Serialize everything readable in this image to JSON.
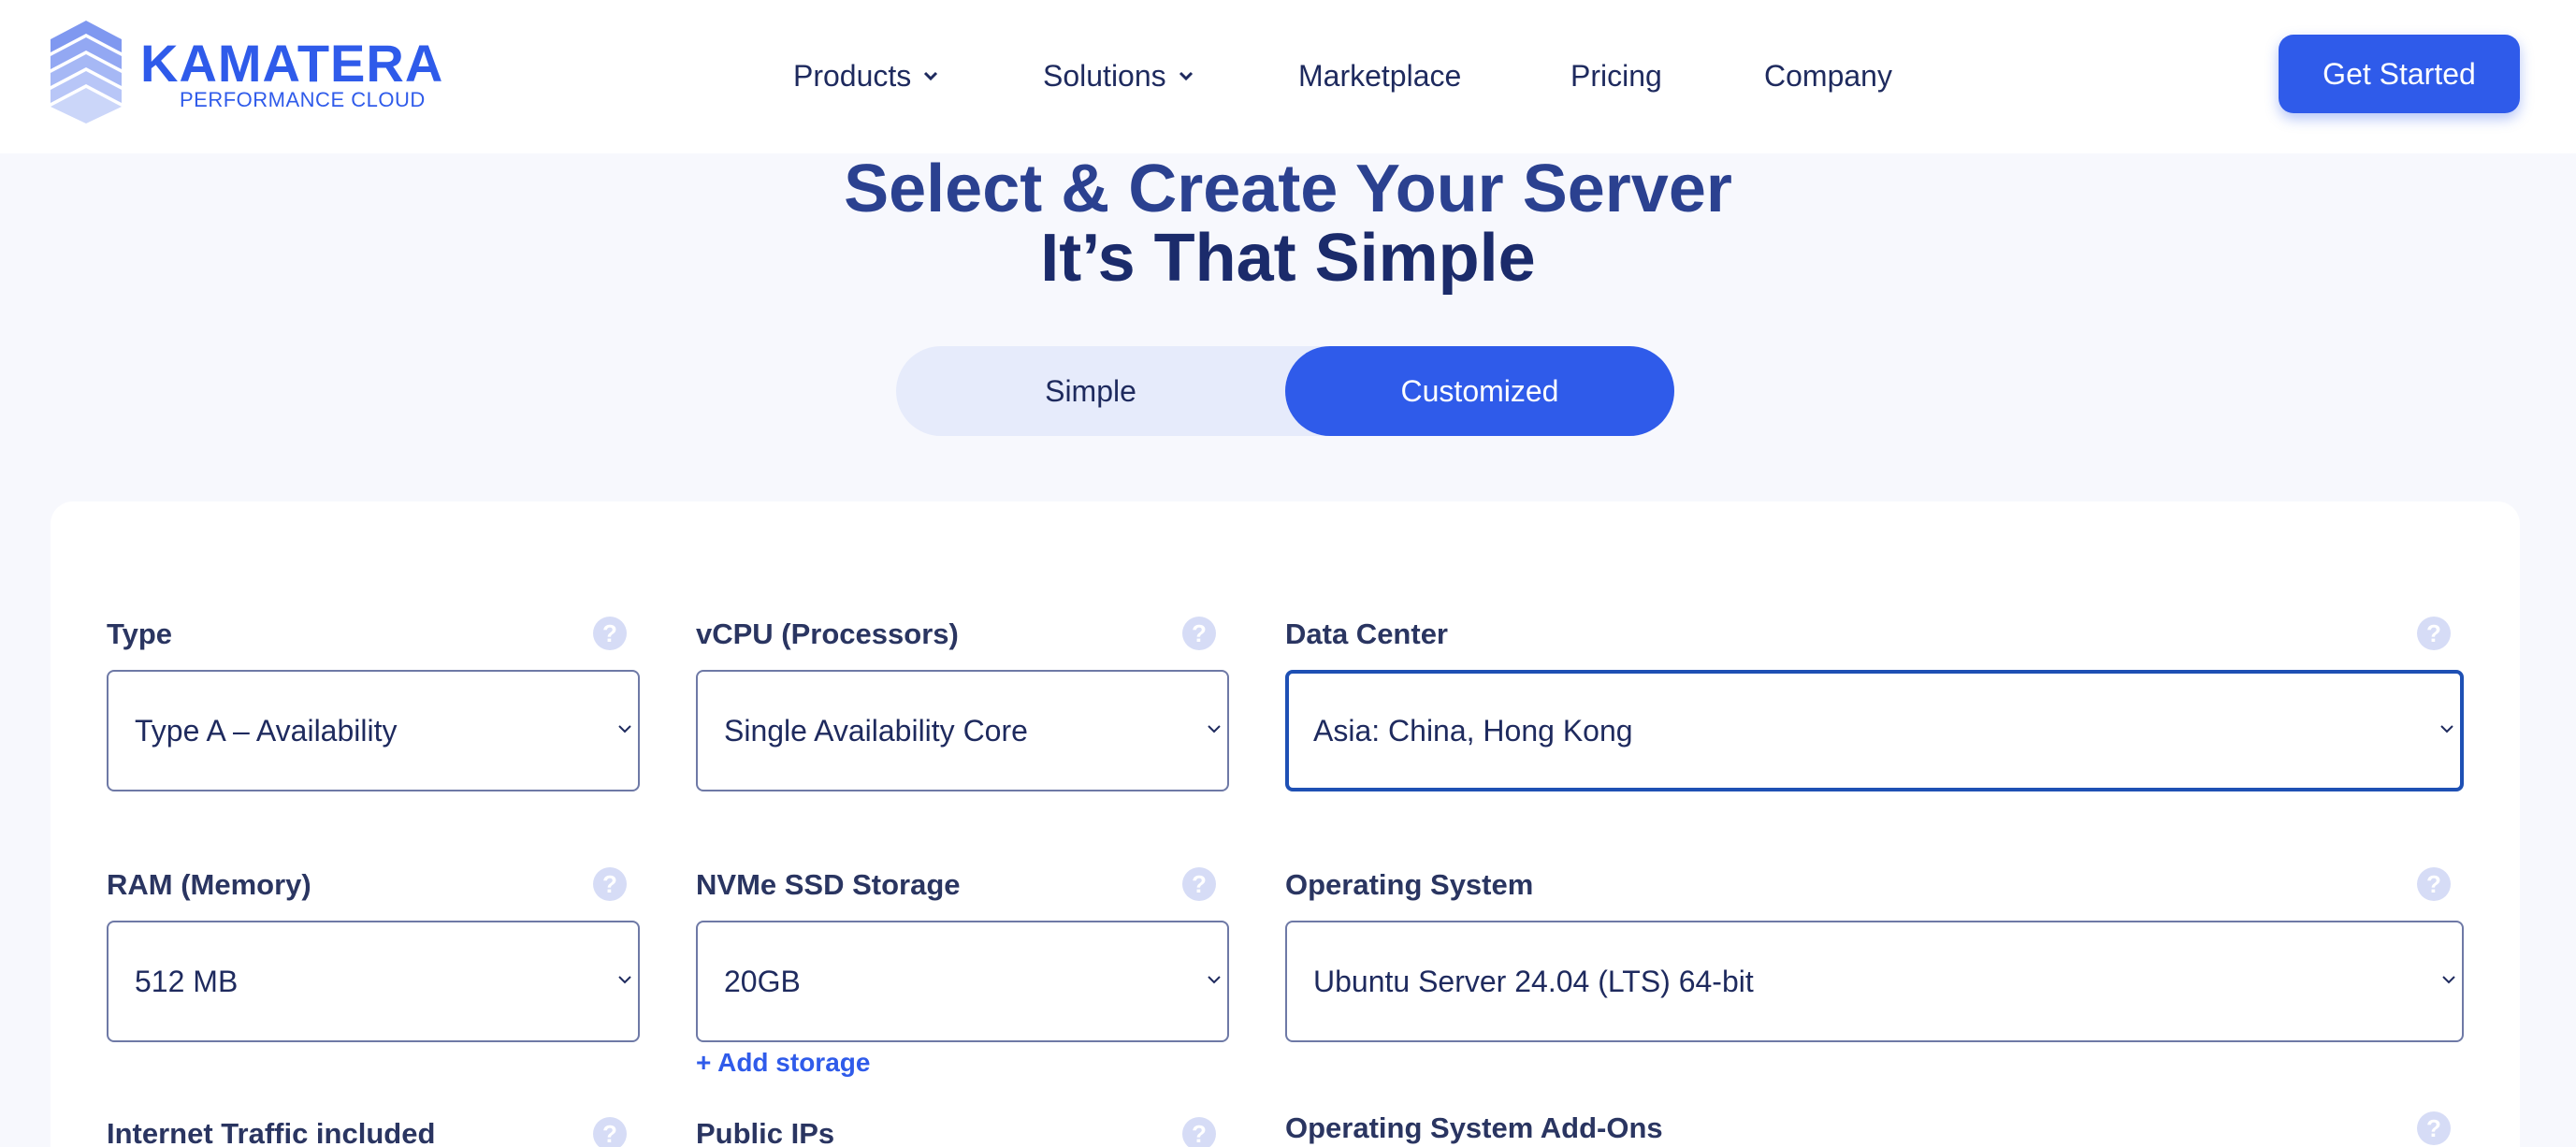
{
  "brand": {
    "name": "KAMATERA",
    "tagline": "PERFORMANCE CLOUD",
    "accent": "#2f5bea"
  },
  "nav": {
    "items": [
      {
        "label": "Products",
        "has_dropdown": true
      },
      {
        "label": "Solutions",
        "has_dropdown": true
      },
      {
        "label": "Marketplace",
        "has_dropdown": false
      },
      {
        "label": "Pricing",
        "has_dropdown": false
      },
      {
        "label": "Company",
        "has_dropdown": false
      }
    ],
    "cta_label": "Get Started"
  },
  "hero": {
    "title_line1": "Select & Create Your Server",
    "title_line2": "It’s That Simple"
  },
  "mode_toggle": {
    "options": [
      "Simple",
      "Customized"
    ],
    "selected": "Customized"
  },
  "config": {
    "type": {
      "label": "Type",
      "value": "Type A – Availability"
    },
    "vcpu": {
      "label": "vCPU (Processors)",
      "value": "Single Availability Core"
    },
    "data_center": {
      "label": "Data Center",
      "value": "Asia: China, Hong Kong"
    },
    "ram": {
      "label": "RAM (Memory)",
      "value": "512 MB"
    },
    "storage": {
      "label": "NVMe SSD Storage",
      "value": "20GB",
      "add_label": "+ Add storage"
    },
    "os": {
      "label": "Operating System",
      "value": "Ubuntu Server 24.04 (LTS) 64-bit"
    },
    "traffic": {
      "label": "Internet Traffic included"
    },
    "public_ips": {
      "label": "Public IPs"
    },
    "os_addons": {
      "label": "Operating System Add-Ons"
    }
  },
  "icons": {
    "help": "question-mark-icon",
    "dropdown": "chevron-down-icon"
  }
}
